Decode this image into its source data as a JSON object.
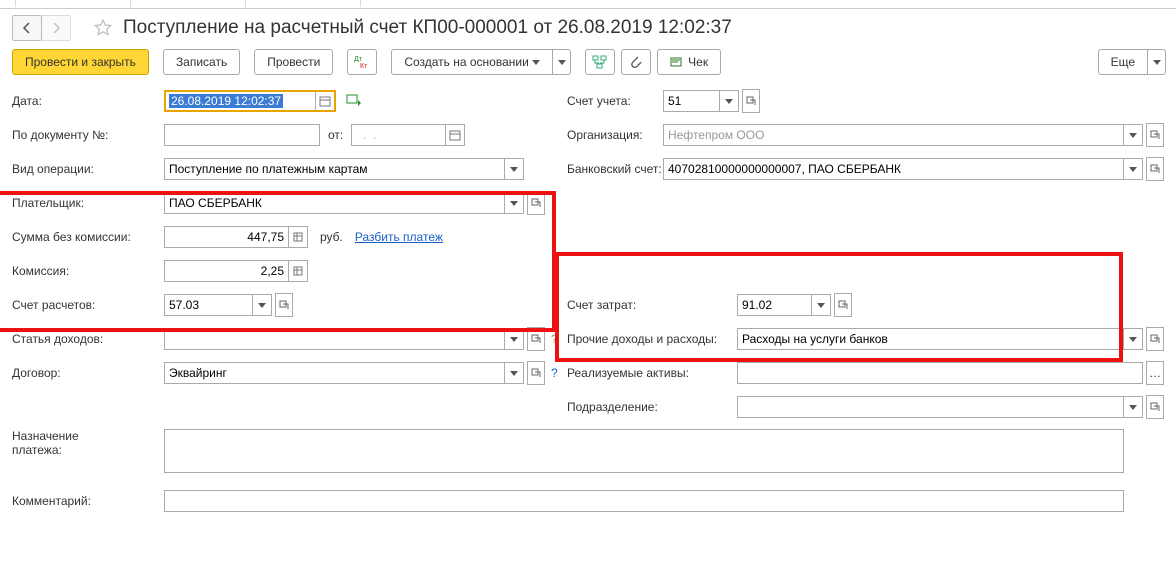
{
  "title": "Поступление на расчетный счет КП00-000001 от 26.08.2019 12:02:37",
  "toolbar": {
    "post_close": "Провести и закрыть",
    "save": "Записать",
    "post": "Провести",
    "create_based": "Создать на основании",
    "cheque": "Чек",
    "more": "Еще"
  },
  "left": {
    "date_lbl": "Дата:",
    "date_val": "26.08.2019 12:02:37",
    "docnum_lbl": "По документу №:",
    "docnum_val": "",
    "from_lbl": "от:",
    "from_val": "  .  .",
    "optype_lbl": "Вид операции:",
    "optype_val": "Поступление по платежным картам",
    "payer_lbl": "Плательщик:",
    "payer_val": "ПАО СБЕРБАНК",
    "sum_lbl": "Сумма без комиссии:",
    "sum_val": "447,75",
    "sum_cur": "руб.",
    "split_link": "Разбить платеж",
    "fee_lbl": "Комиссия:",
    "fee_val": "2,25",
    "settle_acc_lbl": "Счет расчетов:",
    "settle_acc_val": "57.03",
    "income_lbl": "Статья доходов:",
    "income_val": "",
    "contract_lbl": "Договор:",
    "contract_val": "Эквайринг",
    "purpose_lbl": "Назначение\nплатежа:",
    "purpose_val": "",
    "comment_lbl": "Комментарий:",
    "comment_val": ""
  },
  "right": {
    "acc_lbl": "Счет учета:",
    "acc_val": "51",
    "org_lbl": "Организация:",
    "org_val": "Нефтепром ООО",
    "bank_lbl": "Банковский счет:",
    "bank_val": "40702810000000000007, ПАО СБЕРБАНК",
    "cost_acc_lbl": "Счет затрат:",
    "cost_acc_val": "91.02",
    "other_lbl": "Прочие доходы и расходы:",
    "other_val": "Расходы на услуги банков",
    "assets_lbl": "Реализуемые активы:",
    "assets_val": "",
    "dept_lbl": "Подразделение:",
    "dept_val": ""
  }
}
